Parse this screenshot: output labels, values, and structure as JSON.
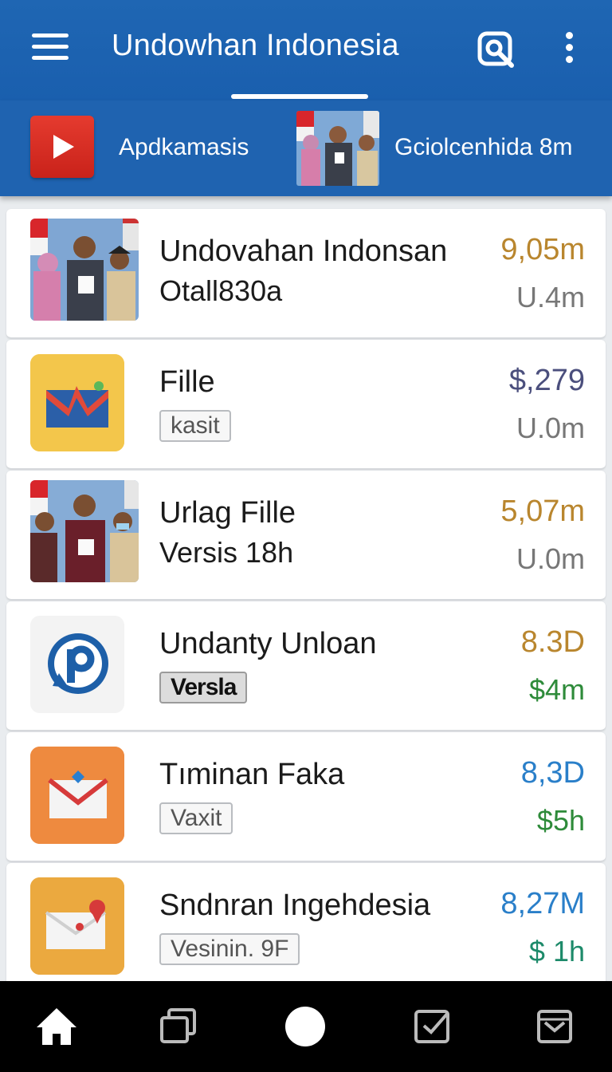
{
  "appbar": {
    "title": "Undowhan Indonesia",
    "menu_icon": "hamburger-menu-icon",
    "search_icon": "search-icon",
    "more_icon": "more-vertical-icon"
  },
  "strip": {
    "items": [
      {
        "label": "Apdkamasis",
        "icon": "play-icon"
      },
      {
        "label": "Gciolcenhida 8m",
        "icon": "group-photo-thumbnail"
      }
    ]
  },
  "list": {
    "items": [
      {
        "title": "Undovahan Indonsan",
        "subtitle": "Otall830a",
        "value": "9,05m",
        "secondary": "U.4m",
        "value_color": "#b9862e",
        "secondary_color": "#777777",
        "thumb": "group-photo"
      },
      {
        "title": "Fille",
        "tag": "kasit",
        "value": "$,279",
        "secondary": "U.0m",
        "value_color": "#4b4f7d",
        "secondary_color": "#777777",
        "thumb": "folder-app-icon"
      },
      {
        "title": "Urlag Fille",
        "subtitle": "Versis 18h",
        "value": "5,07m",
        "secondary": "U.0m",
        "value_color": "#b9862e",
        "secondary_color": "#777777",
        "thumb": "group-photo"
      },
      {
        "title": "Undanty Unloan",
        "tag": "Versla",
        "value": "8.3D",
        "secondary": "$4m",
        "value_color": "#b9862e",
        "secondary_color": "#2e8b3a",
        "thumb": "p-app-icon"
      },
      {
        "title": "Tıminan Faka",
        "tag": "Vaxit",
        "value": "8,3D",
        "secondary": "$5h",
        "value_color": "#2a7fc9",
        "secondary_color": "#2e8b3a",
        "thumb": "mail-app-icon"
      },
      {
        "title": "Sndnran Ingehdesia",
        "tag": "Vesinin. 9F",
        "value": "8,27M",
        "secondary": "$ 1h",
        "value_color": "#2a7fc9",
        "secondary_color": "#1d8a6a",
        "thumb": "mail-pin-app-icon"
      }
    ]
  },
  "bottomnav": {
    "items": [
      "home-icon",
      "recent-apps-icon",
      "home-circle-icon",
      "checkbox-icon",
      "checkbox-icon"
    ]
  }
}
